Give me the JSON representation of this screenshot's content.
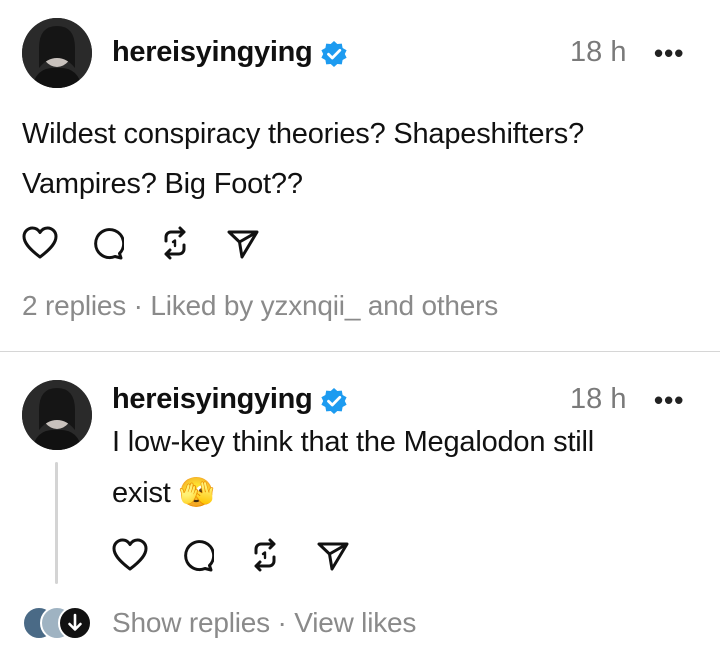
{
  "post": {
    "username": "hereisyingying",
    "time": "18 h",
    "more": "•••",
    "text_line1": "Wildest conspiracy theories? Shapeshifters?",
    "text_line2": "Vampires? Big Foot??",
    "meta_replies": "2 replies",
    "meta_sep": "·",
    "meta_liked": "Liked by yzxnqii_ and others"
  },
  "reply": {
    "username": "hereisyingying",
    "time": "18 h",
    "more": "•••",
    "text_line1": "I low-key think that the Megalodon still",
    "text_line2": "exist",
    "emoji": "🫣"
  },
  "footer": {
    "show_replies": "Show replies",
    "sep": "·",
    "view_likes": "View likes"
  },
  "colors": {
    "verified": "#1d9bf0",
    "muted_text": "#8a8a8a"
  },
  "icons": [
    "heart-icon",
    "comment-icon",
    "repost-icon",
    "share-icon",
    "verified-icon",
    "more-icon",
    "arrow-down-icon"
  ]
}
